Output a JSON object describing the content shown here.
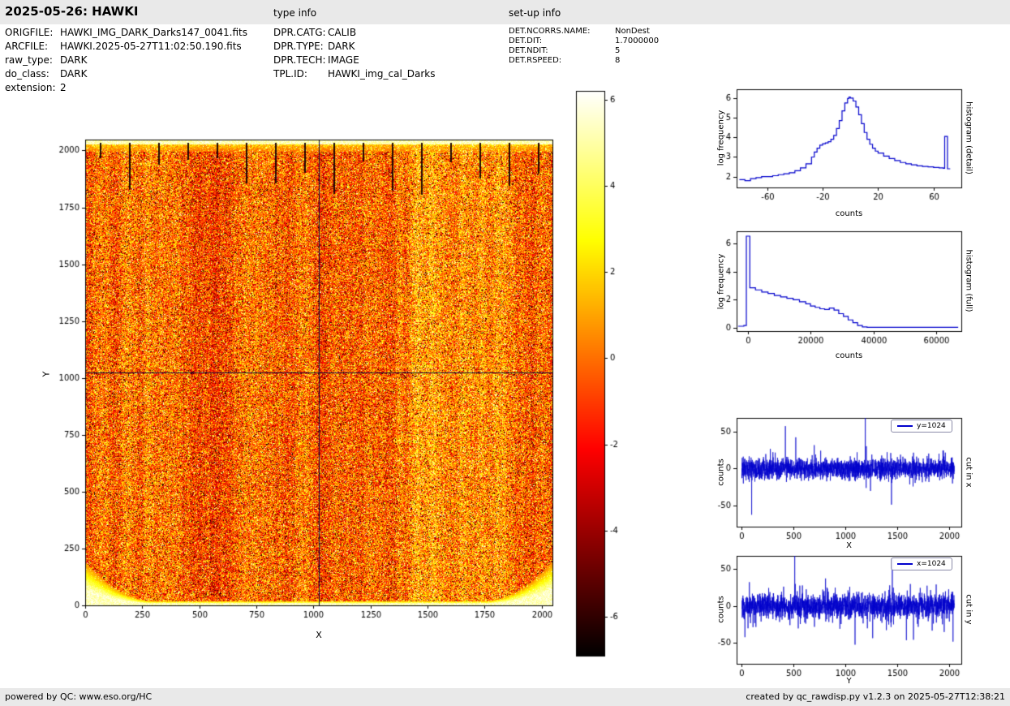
{
  "header": {
    "title": "2025-05-26: HAWKI",
    "type_info_label": "type info",
    "setup_info_label": "set-up info"
  },
  "file_info": {
    "rows": [
      {
        "label": "ORIGFILE:",
        "value": "HAWKI_IMG_DARK_Darks147_0041.fits"
      },
      {
        "label": "ARCFILE:",
        "value": "HAWKI.2025-05-27T11:02:50.190.fits"
      },
      {
        "label": "raw_type:",
        "value": "DARK"
      },
      {
        "label": "do_class:",
        "value": "DARK"
      },
      {
        "label": "extension:",
        "value": "2"
      }
    ]
  },
  "type_info": {
    "rows": [
      {
        "label": "DPR.CATG:",
        "value": "CALIB"
      },
      {
        "label": "DPR.TYPE:",
        "value": "DARK"
      },
      {
        "label": "DPR.TECH:",
        "value": "IMAGE"
      },
      {
        "label": "TPL.ID:",
        "value": "HAWKI_img_cal_Darks"
      }
    ]
  },
  "setup_info": {
    "rows": [
      {
        "label": "DET.NCORRS.NAME:",
        "value": "NonDest"
      },
      {
        "label": "DET.DIT:",
        "value": "1.7000000"
      },
      {
        "label": "DET.NDIT:",
        "value": "5"
      },
      {
        "label": "DET.RSPEED:",
        "value": "8"
      }
    ]
  },
  "footer": {
    "left": "powered by QC: www.eso.org/HC",
    "right": "created by qc_rawdisp.py v1.2.3 on 2025-05-27T12:38:21"
  },
  "chart_data": [
    {
      "id": "main_image",
      "type": "heatmap",
      "xlabel": "X",
      "ylabel": "Y",
      "xlim": [
        0,
        2048
      ],
      "ylim": [
        0,
        2048
      ],
      "xticks": [
        0,
        250,
        500,
        750,
        1000,
        1250,
        1500,
        1750,
        2000
      ],
      "yticks": [
        0,
        250,
        500,
        750,
        1000,
        1250,
        1500,
        1750,
        2000
      ],
      "colormap": "hot",
      "value_range": [
        -6,
        6
      ],
      "crosshair": {
        "x": 1024,
        "y": 1024
      },
      "description": "2048x2048 HAWK-I raw dark frame: mottled noise near 0 counts on hot colormap, bright top edge with dark channel tick marks, bright bottom edge curving up at the corners, dark crosshair lines at x=1024 and y=1024"
    },
    {
      "id": "colorbar",
      "type": "colorbar",
      "colormap": "hot",
      "ticks": [
        6,
        4,
        2,
        0,
        -2,
        -4,
        -6
      ],
      "range": [
        -6.9,
        6.2
      ]
    },
    {
      "id": "hist_detail",
      "type": "line",
      "style": "step",
      "xlabel": "counts",
      "ylabel": "log frequency",
      "side_label": "histogram (detail)",
      "color": "#0000cc",
      "xlim": [
        -82,
        80
      ],
      "ylim": [
        1.45,
        6.45
      ],
      "xticks": [
        -60,
        -20,
        20,
        60
      ],
      "yticks": [
        2,
        3,
        4,
        5,
        6
      ],
      "points": [
        [
          -80,
          1.85
        ],
        [
          -76,
          1.8
        ],
        [
          -72,
          1.9
        ],
        [
          -68,
          1.95
        ],
        [
          -64,
          2.0
        ],
        [
          -60,
          2.0
        ],
        [
          -56,
          2.05
        ],
        [
          -52,
          2.1
        ],
        [
          -48,
          2.15
        ],
        [
          -44,
          2.2
        ],
        [
          -40,
          2.3
        ],
        [
          -36,
          2.45
        ],
        [
          -32,
          2.65
        ],
        [
          -28,
          3.0
        ],
        [
          -26,
          3.25
        ],
        [
          -24,
          3.45
        ],
        [
          -22,
          3.6
        ],
        [
          -20,
          3.68
        ],
        [
          -18,
          3.72
        ],
        [
          -16,
          3.78
        ],
        [
          -14,
          3.9
        ],
        [
          -12,
          4.1
        ],
        [
          -10,
          4.45
        ],
        [
          -8,
          4.85
        ],
        [
          -6,
          5.35
        ],
        [
          -4,
          5.75
        ],
        [
          -2,
          5.98
        ],
        [
          -1,
          6.05
        ],
        [
          0,
          6.0
        ],
        [
          2,
          5.85
        ],
        [
          4,
          5.55
        ],
        [
          6,
          5.15
        ],
        [
          8,
          4.7
        ],
        [
          10,
          4.25
        ],
        [
          12,
          3.9
        ],
        [
          14,
          3.65
        ],
        [
          16,
          3.45
        ],
        [
          18,
          3.3
        ],
        [
          20,
          3.2
        ],
        [
          24,
          3.05
        ],
        [
          28,
          2.92
        ],
        [
          32,
          2.82
        ],
        [
          36,
          2.72
        ],
        [
          40,
          2.65
        ],
        [
          44,
          2.6
        ],
        [
          48,
          2.55
        ],
        [
          52,
          2.52
        ],
        [
          56,
          2.5
        ],
        [
          60,
          2.47
        ],
        [
          64,
          2.45
        ],
        [
          67,
          2.43
        ],
        [
          68,
          4.05
        ],
        [
          70,
          2.4
        ],
        [
          72,
          2.4
        ]
      ]
    },
    {
      "id": "hist_full",
      "type": "line",
      "style": "step",
      "xlabel": "counts",
      "ylabel": "log frequency",
      "side_label": "histogram (full)",
      "color": "#0000cc",
      "xlim": [
        -3500,
        68000
      ],
      "ylim": [
        -0.25,
        6.9
      ],
      "xticks": [
        0,
        20000,
        40000,
        60000
      ],
      "yticks": [
        0,
        2,
        4,
        6
      ],
      "points": [
        [
          -3000,
          0.1
        ],
        [
          -1200,
          0.15
        ],
        [
          -400,
          6.55
        ],
        [
          700,
          2.85
        ],
        [
          2500,
          2.7
        ],
        [
          4500,
          2.55
        ],
        [
          6500,
          2.45
        ],
        [
          8500,
          2.3
        ],
        [
          10500,
          2.2
        ],
        [
          12500,
          2.1
        ],
        [
          14500,
          2.0
        ],
        [
          16500,
          1.85
        ],
        [
          18500,
          1.7
        ],
        [
          20000,
          1.55
        ],
        [
          21500,
          1.45
        ],
        [
          23000,
          1.35
        ],
        [
          24500,
          1.3
        ],
        [
          26000,
          1.4
        ],
        [
          27500,
          1.25
        ],
        [
          29000,
          1.0
        ],
        [
          30500,
          0.8
        ],
        [
          32000,
          0.55
        ],
        [
          33500,
          0.35
        ],
        [
          35000,
          0.15
        ],
        [
          36500,
          0.05
        ],
        [
          38000,
          0.02
        ],
        [
          67000,
          0.02
        ]
      ]
    },
    {
      "id": "cut_x",
      "type": "line",
      "xlabel": "X",
      "ylabel": "counts",
      "side_label": "cut in x",
      "legend": "y=1024",
      "color": "#0000cc",
      "xlim": [
        -50,
        2115
      ],
      "ylim": [
        -78,
        68
      ],
      "xticks": [
        0,
        500,
        1000,
        1500,
        2000
      ],
      "yticks": [
        -50,
        0,
        50
      ],
      "noise": {
        "n": 2048,
        "sigma": 7,
        "seed": 12345
      },
      "spikes": [
        [
          15,
          -20
        ],
        [
          95,
          -62
        ],
        [
          300,
          22
        ],
        [
          420,
          57
        ],
        [
          430,
          -18
        ],
        [
          520,
          42
        ],
        [
          760,
          24
        ],
        [
          1190,
          68
        ],
        [
          1200,
          30
        ],
        [
          1240,
          -30
        ],
        [
          1400,
          22
        ],
        [
          1650,
          -24
        ],
        [
          1900,
          20
        ],
        [
          2030,
          -20
        ]
      ]
    },
    {
      "id": "cut_y",
      "type": "line",
      "xlabel": "Y",
      "ylabel": "counts",
      "side_label": "cut in y",
      "legend": "x=1024",
      "color": "#0000cc",
      "xlim": [
        -50,
        2115
      ],
      "ylim": [
        -78,
        68
      ],
      "xticks": [
        0,
        500,
        1000,
        1500,
        2000
      ],
      "yticks": [
        -50,
        0,
        50
      ],
      "noise": {
        "n": 2048,
        "sigma": 9,
        "seed": 999
      },
      "spikes": [
        [
          30,
          -42
        ],
        [
          60,
          -30
        ],
        [
          510,
          68
        ],
        [
          515,
          30
        ],
        [
          700,
          -28
        ],
        [
          900,
          25
        ],
        [
          1210,
          -30
        ],
        [
          1450,
          64
        ],
        [
          1460,
          25
        ],
        [
          1700,
          -28
        ],
        [
          1950,
          -35
        ],
        [
          2035,
          -48
        ]
      ]
    }
  ]
}
